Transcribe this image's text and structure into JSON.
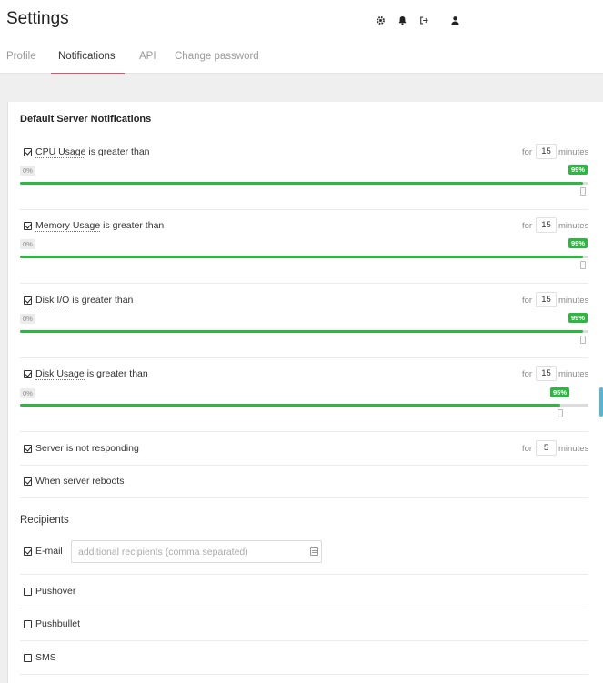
{
  "header": {
    "title": "Settings",
    "icons": [
      "gear-icon",
      "bell-icon",
      "sign-out-icon",
      "user-icon"
    ]
  },
  "tabs": [
    {
      "label": "Profile",
      "active": false
    },
    {
      "label": "Notifications",
      "active": true
    },
    {
      "label": "API",
      "active": false
    },
    {
      "label": "Change password",
      "active": false
    }
  ],
  "section": {
    "title": "Default Server Notifications",
    "for_label": "for",
    "minutes_label": "minutes",
    "slider_min_label": "0%"
  },
  "notifications": [
    {
      "metric": "CPU Usage",
      "suffix": " is greater than",
      "checked": true,
      "minutes": "15",
      "value_label": "99%",
      "value": 0.99
    },
    {
      "metric": "Memory Usage",
      "suffix": " is greater than",
      "checked": true,
      "minutes": "15",
      "value_label": "99%",
      "value": 0.99
    },
    {
      "metric": "Disk I/O",
      "suffix": " is greater than",
      "checked": true,
      "minutes": "15",
      "value_label": "99%",
      "value": 0.99
    },
    {
      "metric": "Disk Usage",
      "suffix": " is greater than",
      "checked": true,
      "minutes": "15",
      "value_label": "95%",
      "value": 0.95
    }
  ],
  "server_not_responding": {
    "label": "Server is not responding",
    "checked": true,
    "minutes": "5"
  },
  "server_reboots": {
    "label": "When server reboots",
    "checked": true
  },
  "recipients": {
    "title": "Recipients",
    "email": {
      "label": "E-mail",
      "checked": true,
      "placeholder": "additional recipients (comma separated)",
      "value": ""
    },
    "pushover": {
      "label": "Pushover",
      "checked": false
    },
    "pushbullet": {
      "label": "Pushbullet",
      "checked": false
    },
    "sms": {
      "label": "SMS",
      "checked": false
    }
  },
  "colors": {
    "accent": "#e0506a",
    "slider_fill": "#2fb542",
    "scroll_thumb": "#55b5d4"
  }
}
